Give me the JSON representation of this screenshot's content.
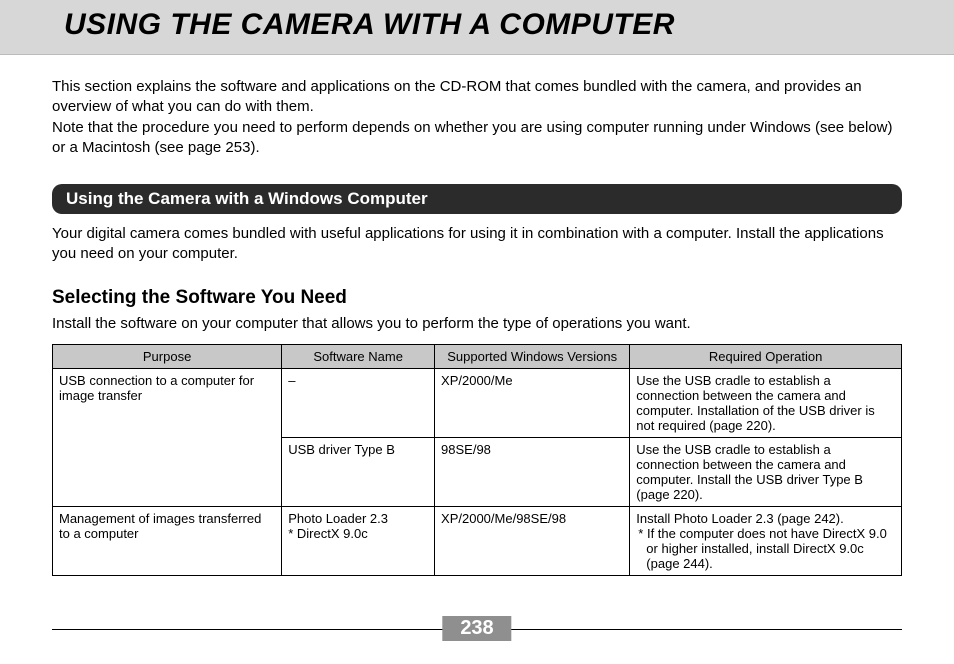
{
  "title": "USING THE CAMERA WITH A COMPUTER",
  "intro_p1": "This section explains the software and applications on the CD-ROM that comes bundled with the camera, and provides an overview of what you can do with them.",
  "intro_p2": "Note that the procedure you need to perform depends on whether you are using computer running under Windows (see below) or a Macintosh (see page 253).",
  "section_bar": "Using the Camera with a Windows Computer",
  "section_body": "Your digital camera comes bundled with useful applications for using it in combination with a computer. Install the applications you need on your computer.",
  "sub_heading": "Selecting the Software You Need",
  "sub_lead": "Install the software on your computer that allows you to perform the type of operations you want.",
  "table": {
    "headers": {
      "purpose": "Purpose",
      "software": "Software Name",
      "versions": "Supported Windows Versions",
      "operation": "Required Operation"
    },
    "rows": [
      {
        "purpose": "USB connection to a computer for image transfer",
        "software": "–",
        "versions": "XP/2000/Me",
        "operation": "Use the USB cradle to establish a connection between the camera and computer. Installation of the USB driver is not required (page 220).",
        "purpose_rowspan": 2
      },
      {
        "software": "USB driver Type B",
        "versions": "98SE/98",
        "operation": "Use the USB cradle to establish a connection between the camera and computer. Install the USB driver Type B (page 220)."
      },
      {
        "purpose": "Management of images transferred to a computer",
        "software_line1": "Photo Loader 2.3",
        "software_line2": "* DirectX 9.0c",
        "versions": "XP/2000/Me/98SE/98",
        "operation_line1": "Install Photo Loader 2.3 (page 242).",
        "operation_line2": "* If the computer does not have DirectX 9.0 or higher installed, install DirectX 9.0c (page 244)."
      }
    ]
  },
  "page_number": "238"
}
